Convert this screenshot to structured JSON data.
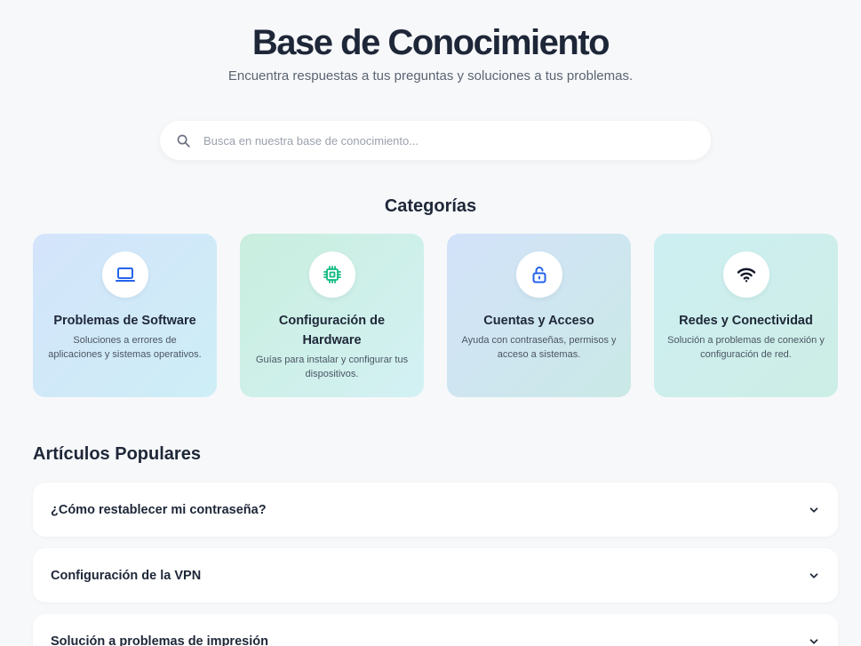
{
  "header": {
    "title": "Base de Conocimiento",
    "subtitle": "Encuentra respuestas a tus preguntas y soluciones a tus problemas."
  },
  "search": {
    "placeholder": "Busca en nuestra base de conocimiento...",
    "value": "",
    "icon": "search-icon"
  },
  "categories": {
    "title": "Categorías",
    "items": [
      {
        "name": "Problemas de Software",
        "description": "Soluciones a errores de aplicaciones y sistemas operativos.",
        "icon": "laptop-icon",
        "icon_color": "#2563eb"
      },
      {
        "name": "Configuración de Hardware",
        "description": "Guías para instalar y configurar tus dispositivos.",
        "icon": "cpu-chip-icon",
        "icon_color": "#10b981"
      },
      {
        "name": "Cuentas y Acceso",
        "description": "Ayuda con contraseñas, permisos y acceso a sistemas.",
        "icon": "lock-icon",
        "icon_color": "#2563eb"
      },
      {
        "name": "Redes y Conectividad",
        "description": "Solución a problemas de conexión y configuración de red.",
        "icon": "wifi-icon",
        "icon_color": "#111827"
      }
    ]
  },
  "articles": {
    "title": "Artículos Populares",
    "items": [
      {
        "title": "¿Cómo restablecer mi contraseña?",
        "icon": "chevron-down-icon"
      },
      {
        "title": "Configuración de la VPN",
        "icon": "chevron-down-icon"
      },
      {
        "title": "Solución a problemas de impresión",
        "icon": "chevron-down-icon"
      }
    ]
  },
  "colors": {
    "background": "#f7f8fa",
    "heading": "#1e2738",
    "muted": "#5b6472"
  }
}
